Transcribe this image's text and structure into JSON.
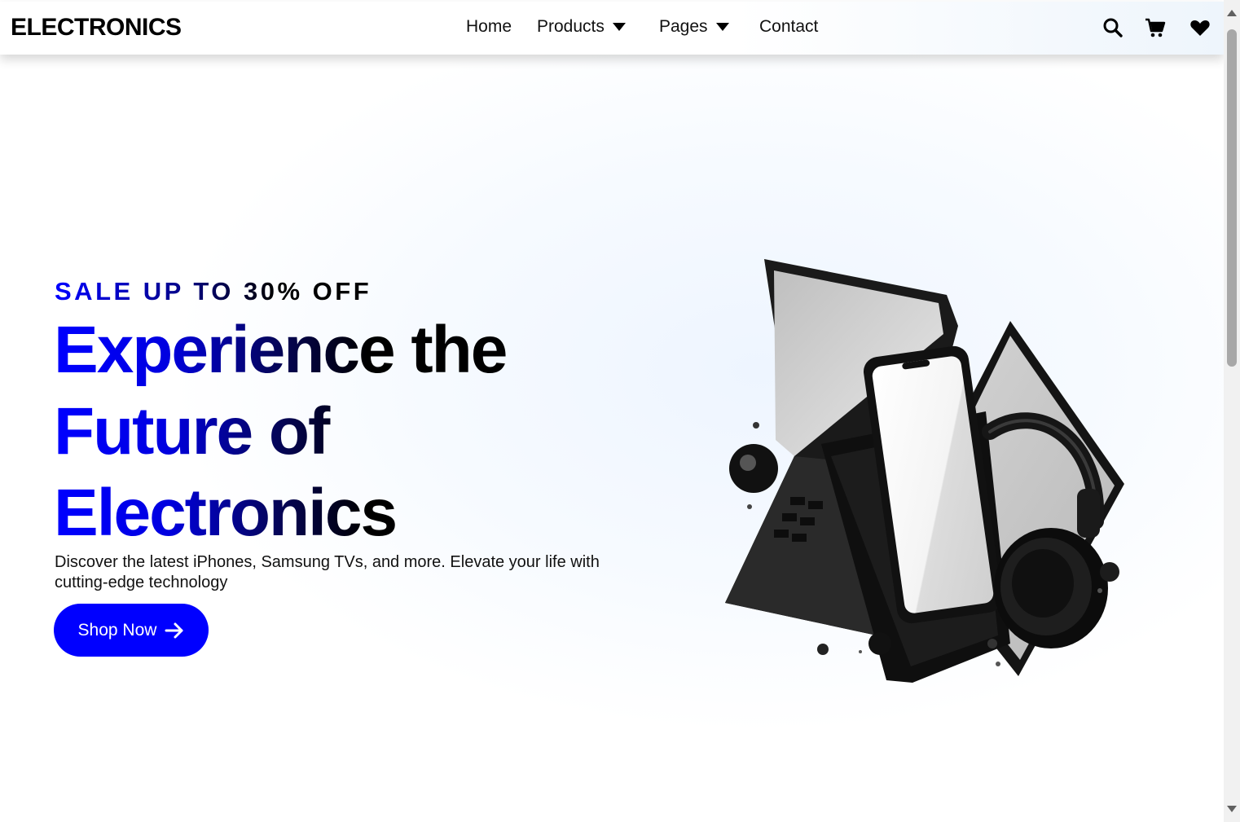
{
  "header": {
    "logo": "ELECTRONICS",
    "nav": [
      {
        "label": "Home",
        "has_dropdown": false
      },
      {
        "label": "Products",
        "has_dropdown": true
      },
      {
        "label": "Pages",
        "has_dropdown": true
      },
      {
        "label": "Contact",
        "has_dropdown": false
      }
    ],
    "icons": [
      "search-icon",
      "cart-icon",
      "heart-icon"
    ]
  },
  "hero": {
    "sale_text": "SALE UP TO 30% OFF",
    "headline": [
      "Experience the",
      "Future of",
      "Electronics"
    ],
    "description": "Discover the latest iPhones, Samsung TVs, and more. Elevate your life with cutting-edge technology",
    "cta_label": "Shop Now",
    "cta_icon": "arrow-right-icon"
  },
  "colors": {
    "accent": "#0000ff",
    "text": "#000000",
    "background": "#f6faff"
  }
}
